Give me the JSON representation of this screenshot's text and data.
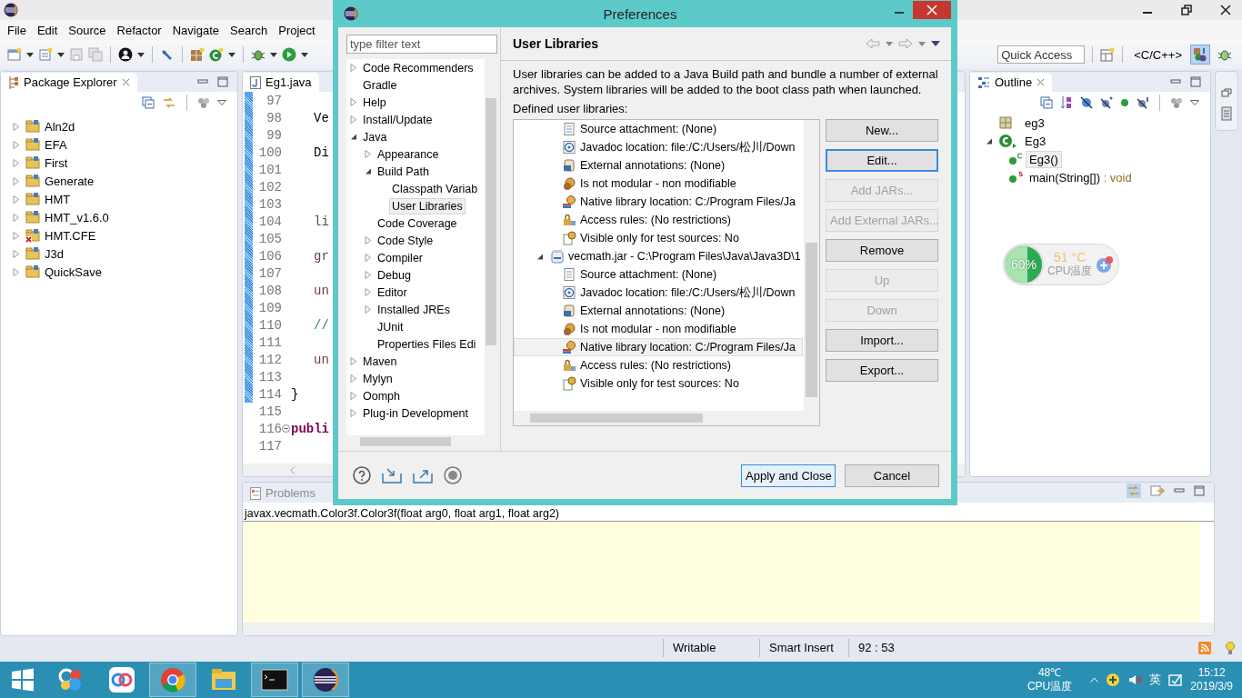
{
  "window": {
    "menu": [
      "File",
      "Edit",
      "Source",
      "Refactor",
      "Navigate",
      "Search",
      "Project"
    ]
  },
  "toolbar": {
    "quick_access": {
      "placeholder": "Quick Access"
    },
    "perspective_label": "<C/C++>",
    "perspectives": [
      {
        "kind": "java",
        "selected": true
      },
      {
        "kind": "debug",
        "selected": false
      }
    ]
  },
  "package_explorer": {
    "title": "Package Explorer",
    "projects": [
      {
        "name": "Aln2d",
        "expanded": false,
        "error": false
      },
      {
        "name": "EFA",
        "expanded": false,
        "error": false
      },
      {
        "name": "First",
        "expanded": false,
        "error": false
      },
      {
        "name": "Generate",
        "expanded": false,
        "error": false
      },
      {
        "name": "HMT",
        "expanded": false,
        "error": false
      },
      {
        "name": "HMT_v1.6.0",
        "expanded": false,
        "error": false
      },
      {
        "name": "HMT.CFE",
        "expanded": false,
        "error": true
      },
      {
        "name": "J3d",
        "expanded": false,
        "error": false
      },
      {
        "name": "QuickSave",
        "expanded": false,
        "error": false
      }
    ]
  },
  "editor": {
    "tab": "Eg1.java",
    "lines": [
      {
        "number": "97",
        "changed": true
      },
      {
        "number": "98",
        "code": "Ve",
        "kind": "plain",
        "changed": true
      },
      {
        "number": "99",
        "changed": true
      },
      {
        "number": "100",
        "code": "Di",
        "kind": "plain",
        "changed": true
      },
      {
        "number": "101",
        "changed": true
      },
      {
        "number": "102",
        "changed": true
      },
      {
        "number": "103",
        "changed": true
      },
      {
        "number": "104",
        "code": "li",
        "kind": "variable",
        "changed": true
      },
      {
        "number": "105",
        "changed": true
      },
      {
        "number": "106",
        "code": "gr",
        "kind": "variable",
        "changed": true
      },
      {
        "number": "107",
        "changed": true
      },
      {
        "number": "108",
        "code": "un",
        "kind": "variable",
        "changed": true
      },
      {
        "number": "109",
        "changed": true
      },
      {
        "number": "110",
        "code": "//",
        "kind": "comment",
        "changed": true
      },
      {
        "number": "111",
        "changed": true
      },
      {
        "number": "112",
        "code": "un",
        "kind": "variable",
        "changed": true
      },
      {
        "number": "113",
        "changed": true
      },
      {
        "number": "114",
        "code": "}",
        "kind": "brace",
        "changed": true
      },
      {
        "number": "115",
        "changed": false
      },
      {
        "number": "116",
        "code": "publi",
        "kind": "keyword",
        "changed": false,
        "fold": true
      },
      {
        "number": "117",
        "changed": false
      }
    ]
  },
  "outline": {
    "title": "Outline",
    "items": [
      {
        "name": "eg3",
        "kind": "package",
        "selected": false
      },
      {
        "name": "Eg3",
        "kind": "class",
        "expanded": true,
        "selected": false,
        "children": [
          {
            "name": "Eg3()",
            "kind": "constructor",
            "selected": true
          },
          {
            "name": "main(String[])",
            "type": " : void",
            "kind": "static-method",
            "selected": false
          }
        ]
      }
    ]
  },
  "cpu_widget": {
    "percent": "60%",
    "level": 0.6,
    "temperature": "51 °C",
    "label": "CPU温度"
  },
  "bottom_panel": {
    "tab": "Problems",
    "signature": "javax.vecmath.Color3f.Color3f(float arg0, float arg1, float arg2)"
  },
  "status_bar": [
    "Writable",
    "Smart Insert",
    "92 : 53"
  ],
  "dialog": {
    "title": "Preferences",
    "filter": {
      "placeholder": "type filter text"
    },
    "tree": [
      {
        "label": "Code Recommenders",
        "expanded": false,
        "selected": false
      },
      {
        "label": "Gradle",
        "selected": false
      },
      {
        "label": "Help",
        "expanded": false,
        "selected": false
      },
      {
        "label": "Install/Update",
        "expanded": false,
        "selected": false
      },
      {
        "label": "Java",
        "expanded": true,
        "selected": false,
        "children": [
          {
            "label": "Appearance",
            "expanded": false,
            "selected": false
          },
          {
            "label": "Build Path",
            "expanded": true,
            "selected": false,
            "children": [
              {
                "label": "Classpath Variab",
                "selected": false
              },
              {
                "label": "User Libraries",
                "selected": true
              }
            ]
          },
          {
            "label": "Code Coverage",
            "selected": false
          },
          {
            "label": "Code Style",
            "expanded": false,
            "selected": false
          },
          {
            "label": "Compiler",
            "expanded": false,
            "selected": false
          },
          {
            "label": "Debug",
            "expanded": false,
            "selected": false
          },
          {
            "label": "Editor",
            "expanded": false,
            "selected": false
          },
          {
            "label": "Installed JREs",
            "expanded": false,
            "selected": false
          },
          {
            "label": "JUnit",
            "selected": false
          },
          {
            "label": "Properties Files Edi",
            "selected": false
          }
        ]
      },
      {
        "label": "Maven",
        "expanded": false,
        "selected": false
      },
      {
        "label": "Mylyn",
        "expanded": false,
        "selected": false
      },
      {
        "label": "Oomph",
        "expanded": false,
        "selected": false
      },
      {
        "label": "Plug-in Development",
        "expanded": false,
        "selected": false
      }
    ],
    "page_title": "User Libraries",
    "description": "User libraries can be added to a Java Build path and bundle a number of external archives. System libraries will be added to the boot class path when launched.",
    "list_label": "Defined user libraries:",
    "libraries": [
      {
        "children": [
          {
            "label": "Source attachment: (None)",
            "kind": "source",
            "selected": false
          },
          {
            "label": "Javadoc location: file:/C:/Users/松川/Down",
            "kind": "javadoc",
            "selected": false
          },
          {
            "label": "External annotations: (None)",
            "kind": "annotations",
            "selected": false
          },
          {
            "label": "Is not modular - non modifiable",
            "kind": "modular",
            "selected": false
          },
          {
            "label": "Native library location: C:/Program Files/Ja",
            "kind": "native",
            "selected": false
          },
          {
            "label": "Access rules: (No restrictions)",
            "kind": "access",
            "selected": false
          },
          {
            "label": "Visible only for test sources: No",
            "kind": "test",
            "selected": false
          }
        ]
      },
      {
        "label": "vecmath.jar - C:\\Program Files\\Java\\Java3D\\1",
        "expanded": true,
        "selected": false,
        "children": [
          {
            "label": "Source attachment: (None)",
            "kind": "source",
            "selected": false
          },
          {
            "label": "Javadoc location: file:/C:/Users/松川/Down",
            "kind": "javadoc",
            "selected": false
          },
          {
            "label": "External annotations: (None)",
            "kind": "annotations",
            "selected": false
          },
          {
            "label": "Is not modular - non modifiable",
            "kind": "modular",
            "selected": false
          },
          {
            "label": "Native library location: C:/Program Files/Ja",
            "kind": "native",
            "selected": true
          },
          {
            "label": "Access rules: (No restrictions)",
            "kind": "access",
            "selected": false
          },
          {
            "label": "Visible only for test sources: No",
            "kind": "test",
            "selected": false
          }
        ]
      }
    ],
    "button_groups": [
      [
        {
          "label": "New...",
          "disabled": false,
          "focused": false
        },
        {
          "label": "Edit...",
          "disabled": false,
          "focused": true
        },
        {
          "label": "Add JARs...",
          "disabled": true,
          "focused": false
        },
        {
          "label": "Add External JARs...",
          "disabled": true,
          "focused": false
        },
        {
          "label": "Remove",
          "disabled": false,
          "focused": false
        }
      ],
      [
        {
          "label": "Up",
          "disabled": true,
          "focused": false
        },
        {
          "label": "Down",
          "disabled": true,
          "focused": false
        }
      ],
      [
        {
          "label": "Import...",
          "disabled": false,
          "focused": false
        },
        {
          "label": "Export...",
          "disabled": false,
          "focused": false
        }
      ]
    ],
    "footer_buttons": [
      {
        "label": "Apply and Close",
        "default": true
      },
      {
        "label": "Cancel",
        "default": false
      }
    ]
  },
  "taskbar": {
    "apps": [
      {
        "kind": "colorful",
        "running": false
      },
      {
        "kind": "cloud",
        "running": false
      },
      {
        "kind": "chrome",
        "running": true
      },
      {
        "kind": "folder",
        "running": false
      },
      {
        "kind": "terminal",
        "running": true
      },
      {
        "kind": "eclipse",
        "running": true
      }
    ],
    "tray": {
      "temperature": "48℃",
      "temperature_label": "CPU温度",
      "ime": "英",
      "time": "15:12",
      "date": "2019/3/9"
    }
  }
}
